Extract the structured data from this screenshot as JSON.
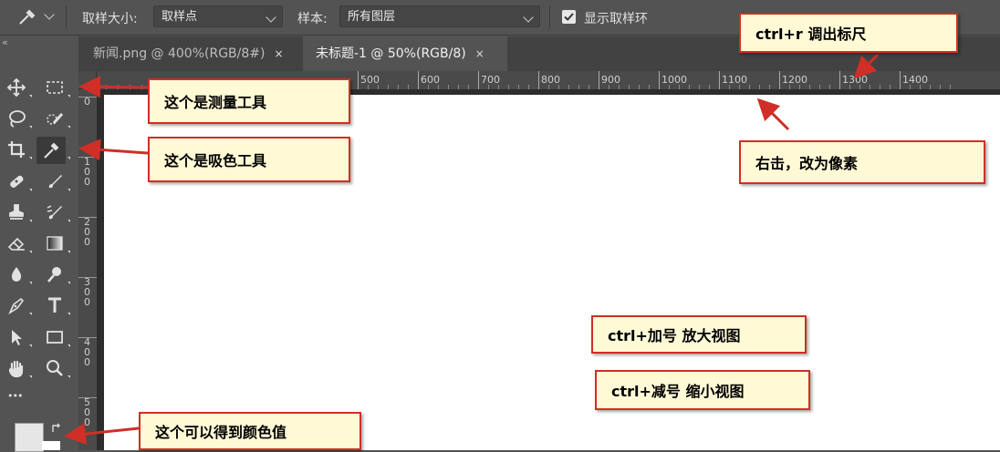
{
  "options_bar": {
    "sample_size_label": "取样大小:",
    "sample_size_value": "取样点",
    "sample_label": "样本:",
    "sample_value": "所有图层",
    "show_ring_label": "显示取样环",
    "show_ring_checked": true
  },
  "tabs": [
    {
      "label": "新闻.png @ 400%(RGB/8#)",
      "close": "×",
      "active": false
    },
    {
      "label": "未标题-1 @ 50%(RGB/8)",
      "close": "×",
      "active": true
    }
  ],
  "ruler": {
    "h_ticks": [
      "500",
      "600",
      "700",
      "800",
      "900",
      "1000",
      "1100",
      "1200",
      "1300",
      "1400"
    ],
    "v_ticks": [
      "0",
      "1\n0\n0",
      "2\n0\n0",
      "3\n0\n0",
      "4\n0\n0",
      "5\n0\n0"
    ]
  },
  "toolbox": {
    "collapse_glyph": "«",
    "tools": [
      "move-icon",
      "marquee-icon",
      "lasso-icon",
      "quick-select-icon",
      "crop-icon",
      "eyedropper-icon",
      "healing-brush-icon",
      "brush-icon",
      "clone-stamp-icon",
      "history-brush-icon",
      "eraser-icon",
      "gradient-icon",
      "blur-icon",
      "dodge-icon",
      "pen-icon",
      "type-icon",
      "path-select-icon",
      "rectangle-icon",
      "hand-icon",
      "zoom-icon"
    ],
    "more_glyph": "•••"
  },
  "annotations": {
    "ruler": "ctrl+r 调出标尺",
    "measure_tool": "这个是测量工具",
    "eyedropper_tool": "这个是吸色工具",
    "right_click": "右击，改为像素",
    "zoom_in": "ctrl+加号 放大视图",
    "zoom_out": "ctrl+减号 缩小视图",
    "color_value": "这个可以得到颜色值"
  },
  "colors": {
    "callout_border": "#cf2f26",
    "callout_fill": "#fff9d6",
    "ui_bg": "#535353",
    "canvas": "#ffffff"
  }
}
